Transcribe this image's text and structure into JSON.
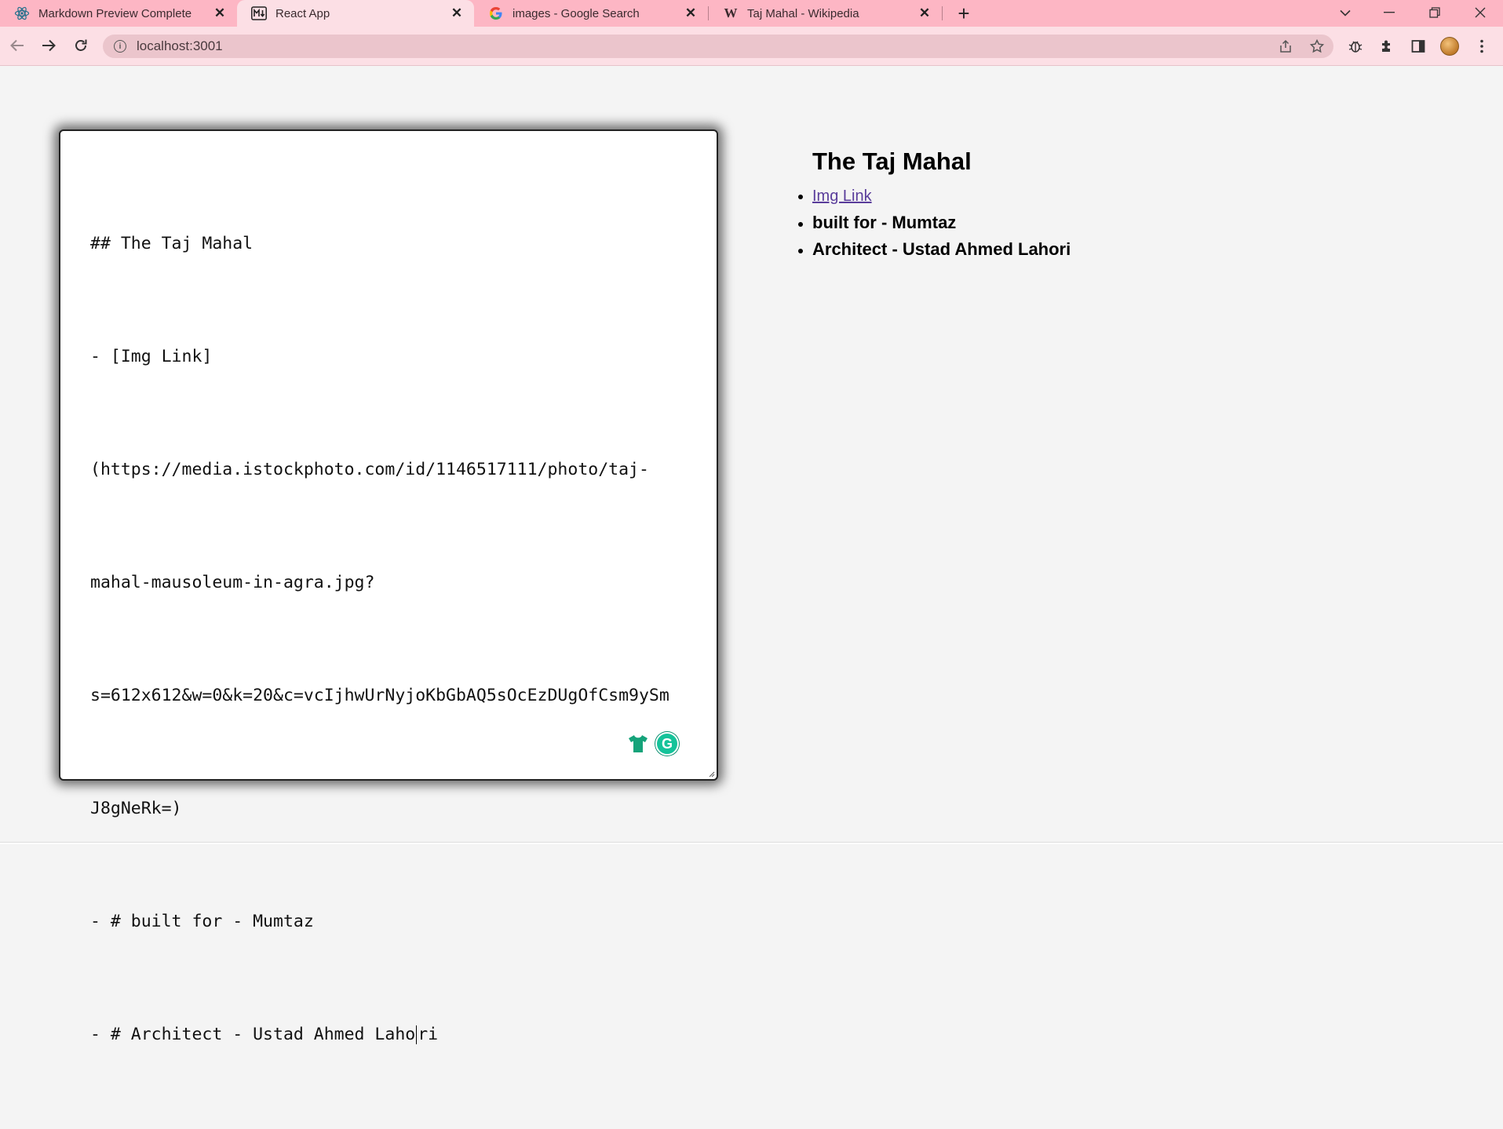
{
  "browser": {
    "tabs": [
      {
        "title": "Markdown Preview Complete",
        "icon": "react-icon",
        "active": false
      },
      {
        "title": "React App",
        "icon": "markdown-icon",
        "active": true
      },
      {
        "title": "images - Google Search",
        "icon": "google-icon",
        "active": false
      },
      {
        "title": "Taj Mahal - Wikipedia",
        "icon": "wikipedia-icon",
        "active": false
      }
    ],
    "url": "localhost:3001",
    "accent_color": "#fdb6c4"
  },
  "editor": {
    "lines": [
      "## The Taj Mahal",
      "- [Img Link]",
      "(https://media.istockphoto.com/id/1146517111/photo/taj-",
      "mahal-mausoleum-in-agra.jpg?",
      "s=612x612&w=0&k=20&c=vcIjhwUrNyjoKbGbAQ5sOcEzDUgOfCsm9ySm",
      "J8gNeRk=)",
      "- # built for - Mumtaz",
      "- # Architect - Ustad Ahmed Laho"
    ],
    "last_line_after_caret": "ri"
  },
  "preview": {
    "heading": "The Taj Mahal",
    "items": [
      {
        "text": "Img Link",
        "type": "link"
      },
      {
        "text": "built for - Mumtaz",
        "type": "bold"
      },
      {
        "text": "Architect - Ustad Ahmed Lahori",
        "type": "bold"
      }
    ]
  }
}
